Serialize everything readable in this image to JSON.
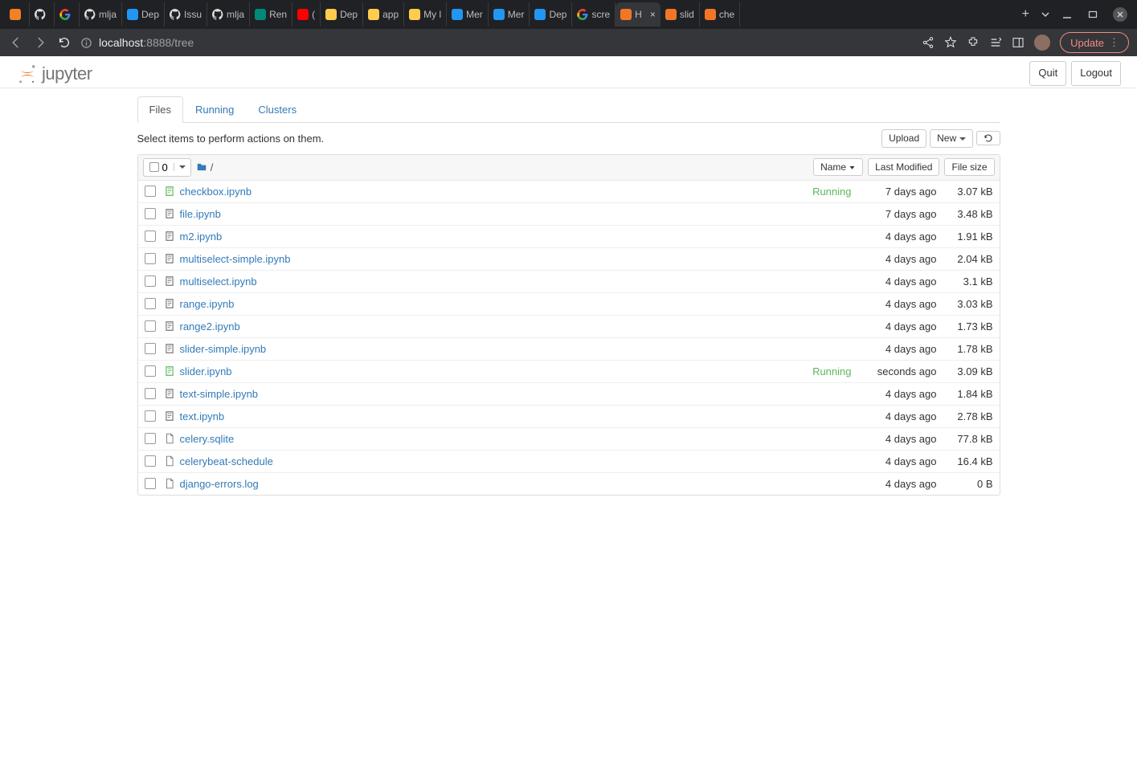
{
  "browser": {
    "tabs": [
      {
        "label": "",
        "icon": "stackoverflow"
      },
      {
        "label": "",
        "icon": "github"
      },
      {
        "label": "",
        "icon": "google"
      },
      {
        "label": "mlja",
        "icon": "github"
      },
      {
        "label": "Dep",
        "icon": "bluedot"
      },
      {
        "label": "Issu",
        "icon": "github"
      },
      {
        "label": "mlja",
        "icon": "github"
      },
      {
        "label": "Ren",
        "icon": "tds"
      },
      {
        "label": "(",
        "icon": "youtube"
      },
      {
        "label": "Dep",
        "icon": "hug"
      },
      {
        "label": "app",
        "icon": "hug"
      },
      {
        "label": "My l",
        "icon": "hug"
      },
      {
        "label": "Mer",
        "icon": "bluedot"
      },
      {
        "label": "Mer",
        "icon": "bluedot"
      },
      {
        "label": "Dep",
        "icon": "bluedot"
      },
      {
        "label": "scre",
        "icon": "google"
      },
      {
        "label": "H",
        "icon": "jupyter",
        "active": true
      },
      {
        "label": "slid",
        "icon": "nb"
      },
      {
        "label": "che",
        "icon": "nb"
      }
    ],
    "url_host": "localhost",
    "url_rest": ":8888/tree",
    "update_label": "Update"
  },
  "header": {
    "logo_text": "jupyter",
    "quit": "Quit",
    "logout": "Logout"
  },
  "tabs": {
    "files": "Files",
    "running": "Running",
    "clusters": "Clusters"
  },
  "toolbar": {
    "hint": "Select items to perform actions on them.",
    "upload": "Upload",
    "new": "New",
    "selected_count": "0",
    "breadcrumb_sep": "/"
  },
  "columns": {
    "name": "Name",
    "modified": "Last Modified",
    "size": "File size"
  },
  "files": [
    {
      "name": "checkbox.ipynb",
      "type": "notebook",
      "running": true,
      "status": "Running",
      "modified": "7 days ago",
      "size": "3.07 kB"
    },
    {
      "name": "file.ipynb",
      "type": "notebook",
      "running": false,
      "status": "",
      "modified": "7 days ago",
      "size": "3.48 kB"
    },
    {
      "name": "m2.ipynb",
      "type": "notebook",
      "running": false,
      "status": "",
      "modified": "4 days ago",
      "size": "1.91 kB"
    },
    {
      "name": "multiselect-simple.ipynb",
      "type": "notebook",
      "running": false,
      "status": "",
      "modified": "4 days ago",
      "size": "2.04 kB"
    },
    {
      "name": "multiselect.ipynb",
      "type": "notebook",
      "running": false,
      "status": "",
      "modified": "4 days ago",
      "size": "3.1 kB"
    },
    {
      "name": "range.ipynb",
      "type": "notebook",
      "running": false,
      "status": "",
      "modified": "4 days ago",
      "size": "3.03 kB"
    },
    {
      "name": "range2.ipynb",
      "type": "notebook",
      "running": false,
      "status": "",
      "modified": "4 days ago",
      "size": "1.73 kB"
    },
    {
      "name": "slider-simple.ipynb",
      "type": "notebook",
      "running": false,
      "status": "",
      "modified": "4 days ago",
      "size": "1.78 kB"
    },
    {
      "name": "slider.ipynb",
      "type": "notebook",
      "running": true,
      "status": "Running",
      "modified": "seconds ago",
      "size": "3.09 kB"
    },
    {
      "name": "text-simple.ipynb",
      "type": "notebook",
      "running": false,
      "status": "",
      "modified": "4 days ago",
      "size": "1.84 kB"
    },
    {
      "name": "text.ipynb",
      "type": "notebook",
      "running": false,
      "status": "",
      "modified": "4 days ago",
      "size": "2.78 kB"
    },
    {
      "name": "celery.sqlite",
      "type": "file",
      "running": false,
      "status": "",
      "modified": "4 days ago",
      "size": "77.8 kB"
    },
    {
      "name": "celerybeat-schedule",
      "type": "file",
      "running": false,
      "status": "",
      "modified": "4 days ago",
      "size": "16.4 kB"
    },
    {
      "name": "django-errors.log",
      "type": "file",
      "running": false,
      "status": "",
      "modified": "4 days ago",
      "size": "0 B"
    }
  ]
}
